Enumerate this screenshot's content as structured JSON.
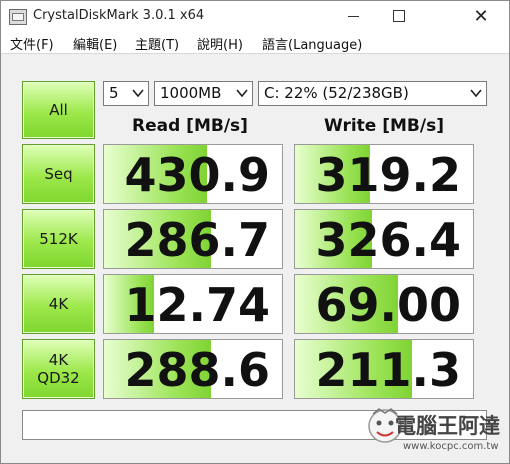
{
  "window": {
    "title": "CrystalDiskMark 3.0.1 x64",
    "controls": {
      "minimize": "—",
      "maximize": "",
      "close": "✕"
    }
  },
  "menu": [
    "文件(F)",
    "編輯(E)",
    "主題(T)",
    "說明(H)",
    "語言(Language)"
  ],
  "toolbar": {
    "all_button": "All",
    "count": "5",
    "size": "1000MB",
    "drive": "C: 22% (52/238GB)"
  },
  "headers": {
    "read": "Read [MB/s]",
    "write": "Write [MB/s]"
  },
  "tests": [
    {
      "label_line1": "Seq",
      "label_line2": "",
      "read": "430.9",
      "write": "319.2",
      "read_level": 0.58,
      "write_level": 0.42
    },
    {
      "label_line1": "512K",
      "label_line2": "",
      "read": "286.7",
      "write": "326.4",
      "read_level": 0.6,
      "write_level": 0.43
    },
    {
      "label_line1": "4K",
      "label_line2": "",
      "read": "12.74",
      "write": "69.00",
      "read_level": 0.28,
      "write_level": 0.58
    },
    {
      "label_line1": "4K",
      "label_line2": "QD32",
      "read": "288.6",
      "write": "211.3",
      "read_level": 0.6,
      "write_level": 0.66
    }
  ],
  "comment": "",
  "watermark": {
    "name": "電腦王阿達",
    "url": "www.kocpc.com.tw"
  },
  "colors": {
    "button_green": "#9de84b",
    "bar_green": "#9be356",
    "client_bg": "#f0f0f0"
  },
  "icons": [
    "app-icon",
    "chevron-down-icon",
    "watermark-logo-icon"
  ]
}
